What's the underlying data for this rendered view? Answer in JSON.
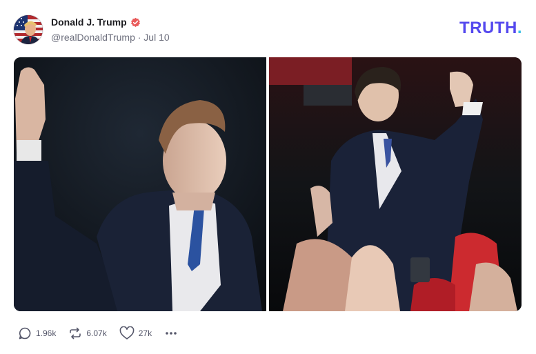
{
  "post": {
    "author": {
      "display_name": "Donald J. Trump",
      "handle_and_date": "@realDonaldTrump · Jul 10",
      "verified": true
    },
    "brand": {
      "logo_text": "TRUTH",
      "logo_dot": "."
    },
    "media": [
      {
        "alt_icon": "photo-young-man-waving"
      },
      {
        "alt_icon": "photo-young-man-fist-raised"
      }
    ],
    "actions": {
      "replies": "1.96k",
      "retruths": "6.07k",
      "likes": "27k"
    },
    "colors": {
      "brand": "#5448ee",
      "brand_dot": "#37c0e6",
      "verified": "#e95a5a",
      "muted_text": "#6d6f7d"
    }
  }
}
